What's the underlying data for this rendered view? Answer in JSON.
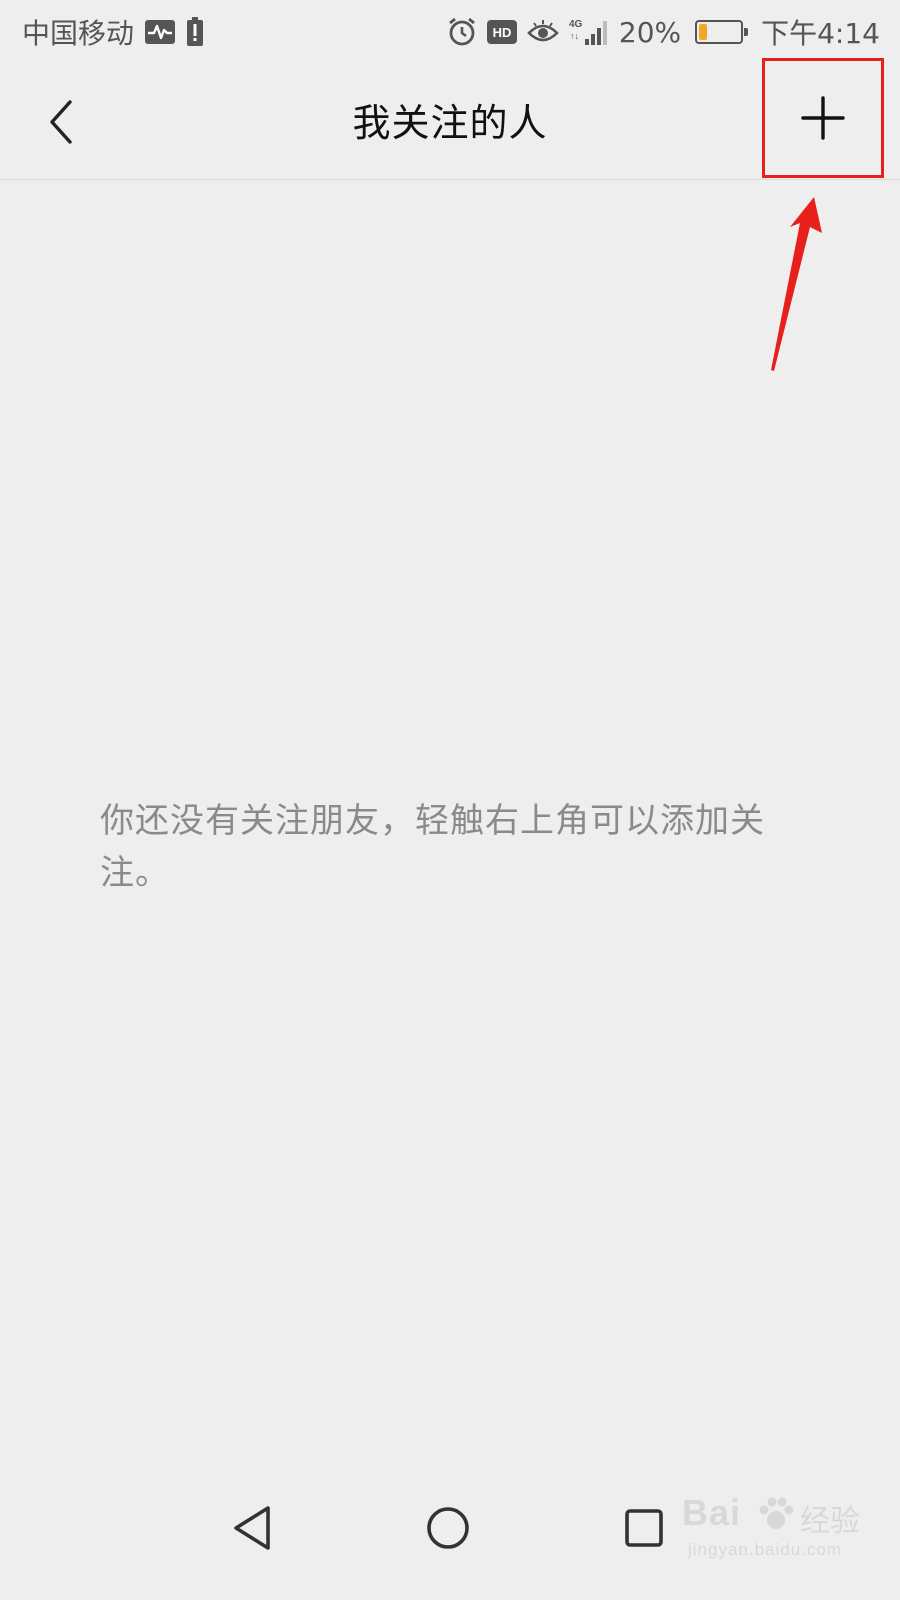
{
  "status_bar": {
    "carrier": "中国移动",
    "network": "4G",
    "battery_percent_text": "20%",
    "battery_level": 0.2,
    "time": "下午4:14",
    "icons": [
      "activity-icon",
      "battery-alert-icon",
      "alarm-icon",
      "hd-icon",
      "eye-icon",
      "signal-icon",
      "battery-icon"
    ]
  },
  "header": {
    "title": "我关注的人",
    "back_icon": "chevron-left-icon",
    "add_icon": "plus-icon"
  },
  "empty_state": {
    "message": "你还没有关注朋友，轻触右上角可以添加关注。"
  },
  "watermark": {
    "brand": "Bai",
    "brand_tail": "经验",
    "sub": "jingyan.baidu.com"
  },
  "colors": {
    "background": "#eeeeee",
    "annotation": "#e8201c",
    "battery_fill": "#f5a623",
    "hint_text": "#8a8a8a"
  }
}
